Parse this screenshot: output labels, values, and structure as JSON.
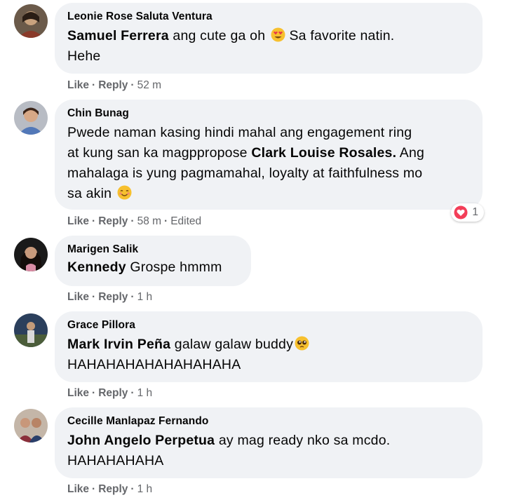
{
  "comments": [
    {
      "author": "Leonie Rose Saluta Ventura",
      "mention": "Samuel Ferrera",
      "text1": " ang cute ga oh ",
      "emoji": "heart-eyes-emoji",
      "text2": " Sa favorite natin.",
      "text3": "Hehe",
      "like": "Like",
      "reply": "Reply",
      "time": "52 m"
    },
    {
      "author": "Chin Bunag",
      "text_line1": "Pwede naman kasing hindi mahal ang engagement ring",
      "text_line2a": "at kung san ka magppropose ",
      "mention": "Clark Louise Rosales.",
      "text_line2b": " Ang",
      "text_line3": "mahalaga is yung pagmamahal, loyalty at faithfulness mo",
      "text_line4": "sa akin ",
      "emoji": "smiling-face-emoji",
      "like": "Like",
      "reply": "Reply",
      "time": "58 m",
      "edited": "Edited",
      "reaction_icon": "heart-reaction-icon",
      "reaction_count": "1"
    },
    {
      "author": "Marigen Salik",
      "mention": "Kennedy",
      "text": " Grospe hmmm",
      "like": "Like",
      "reply": "Reply",
      "time": "1 h"
    },
    {
      "author": "Grace Pillora",
      "mention": "Mark Irvin Peña",
      "text1": " galaw galaw buddy",
      "emoji": "pleading-face-emoji",
      "text2": "HAHAHAHAHAHAHAHAHA",
      "like": "Like",
      "reply": "Reply",
      "time": "1 h"
    },
    {
      "author": "Cecille Manlapaz Fernando",
      "mention": "John Angelo Perpetua",
      "text1": " ay mag ready nko sa mcdo.",
      "text2": "HAHAHAHAHA",
      "like": "Like",
      "reply": "Reply",
      "time": "1 h"
    }
  ],
  "colors": {
    "bubble": "#f0f2f5",
    "meta": "#65676b",
    "text": "#050505",
    "heart": "#f33e58"
  }
}
